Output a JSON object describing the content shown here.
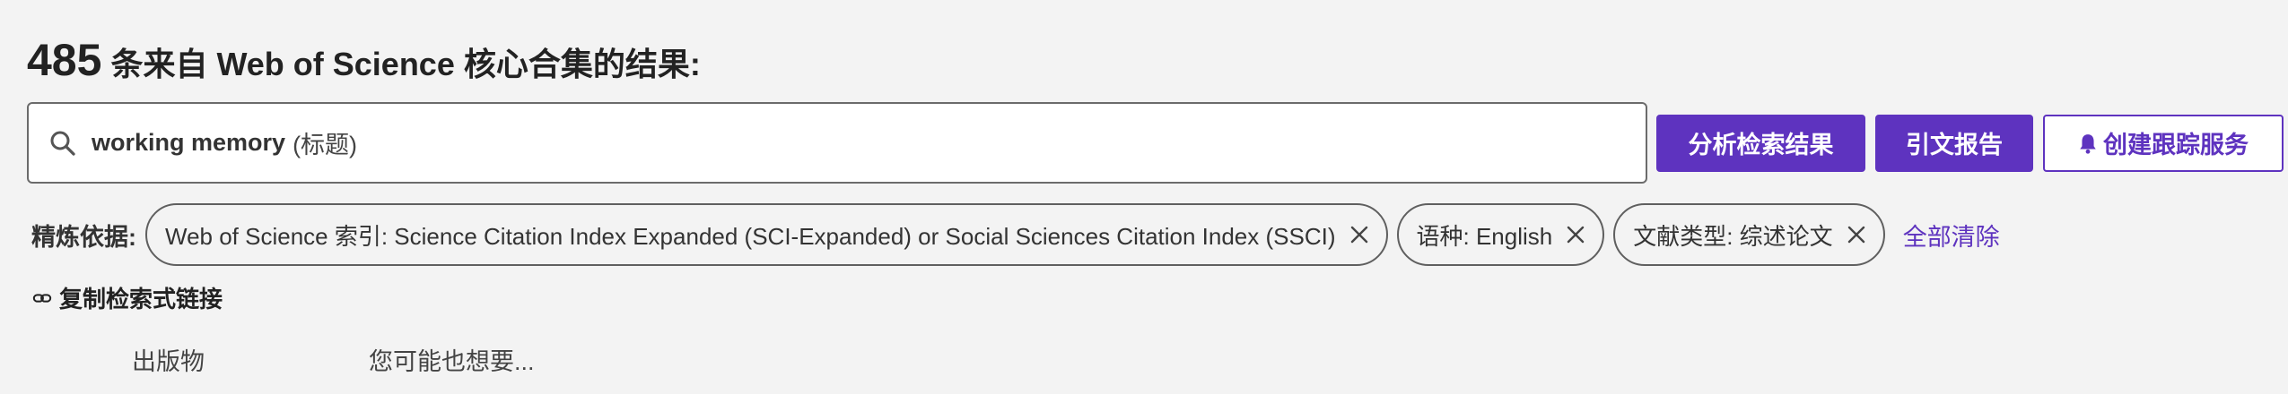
{
  "header": {
    "result_count": "485",
    "result_text": "条来自 Web of Science 核心合集的结果:"
  },
  "search": {
    "query": "working memory",
    "field": "(标题)"
  },
  "actions": {
    "analyze_label": "分析检索结果",
    "citation_report_label": "引文报告",
    "create_alert_label": "创建跟踪服务"
  },
  "refine": {
    "label": "精炼依据:",
    "chips": [
      {
        "text": "Web of Science 索引: Science Citation Index Expanded (SCI-Expanded) or Social Sciences Citation Index (SSCI)"
      },
      {
        "text": "语种: English"
      },
      {
        "text": "文献类型: 综述论文"
      }
    ],
    "clear_all_label": "全部清除"
  },
  "copy_link": {
    "label": "复制检索式链接"
  },
  "bottom": {
    "publications_label": "出版物",
    "suggest_label": "您可能也想要..."
  },
  "colors": {
    "accent": "#5e33bf",
    "background": "#f3f3f3"
  },
  "icons": {
    "search": "search-icon",
    "bell": "bell-icon",
    "close": "close-icon",
    "link": "link-icon"
  }
}
